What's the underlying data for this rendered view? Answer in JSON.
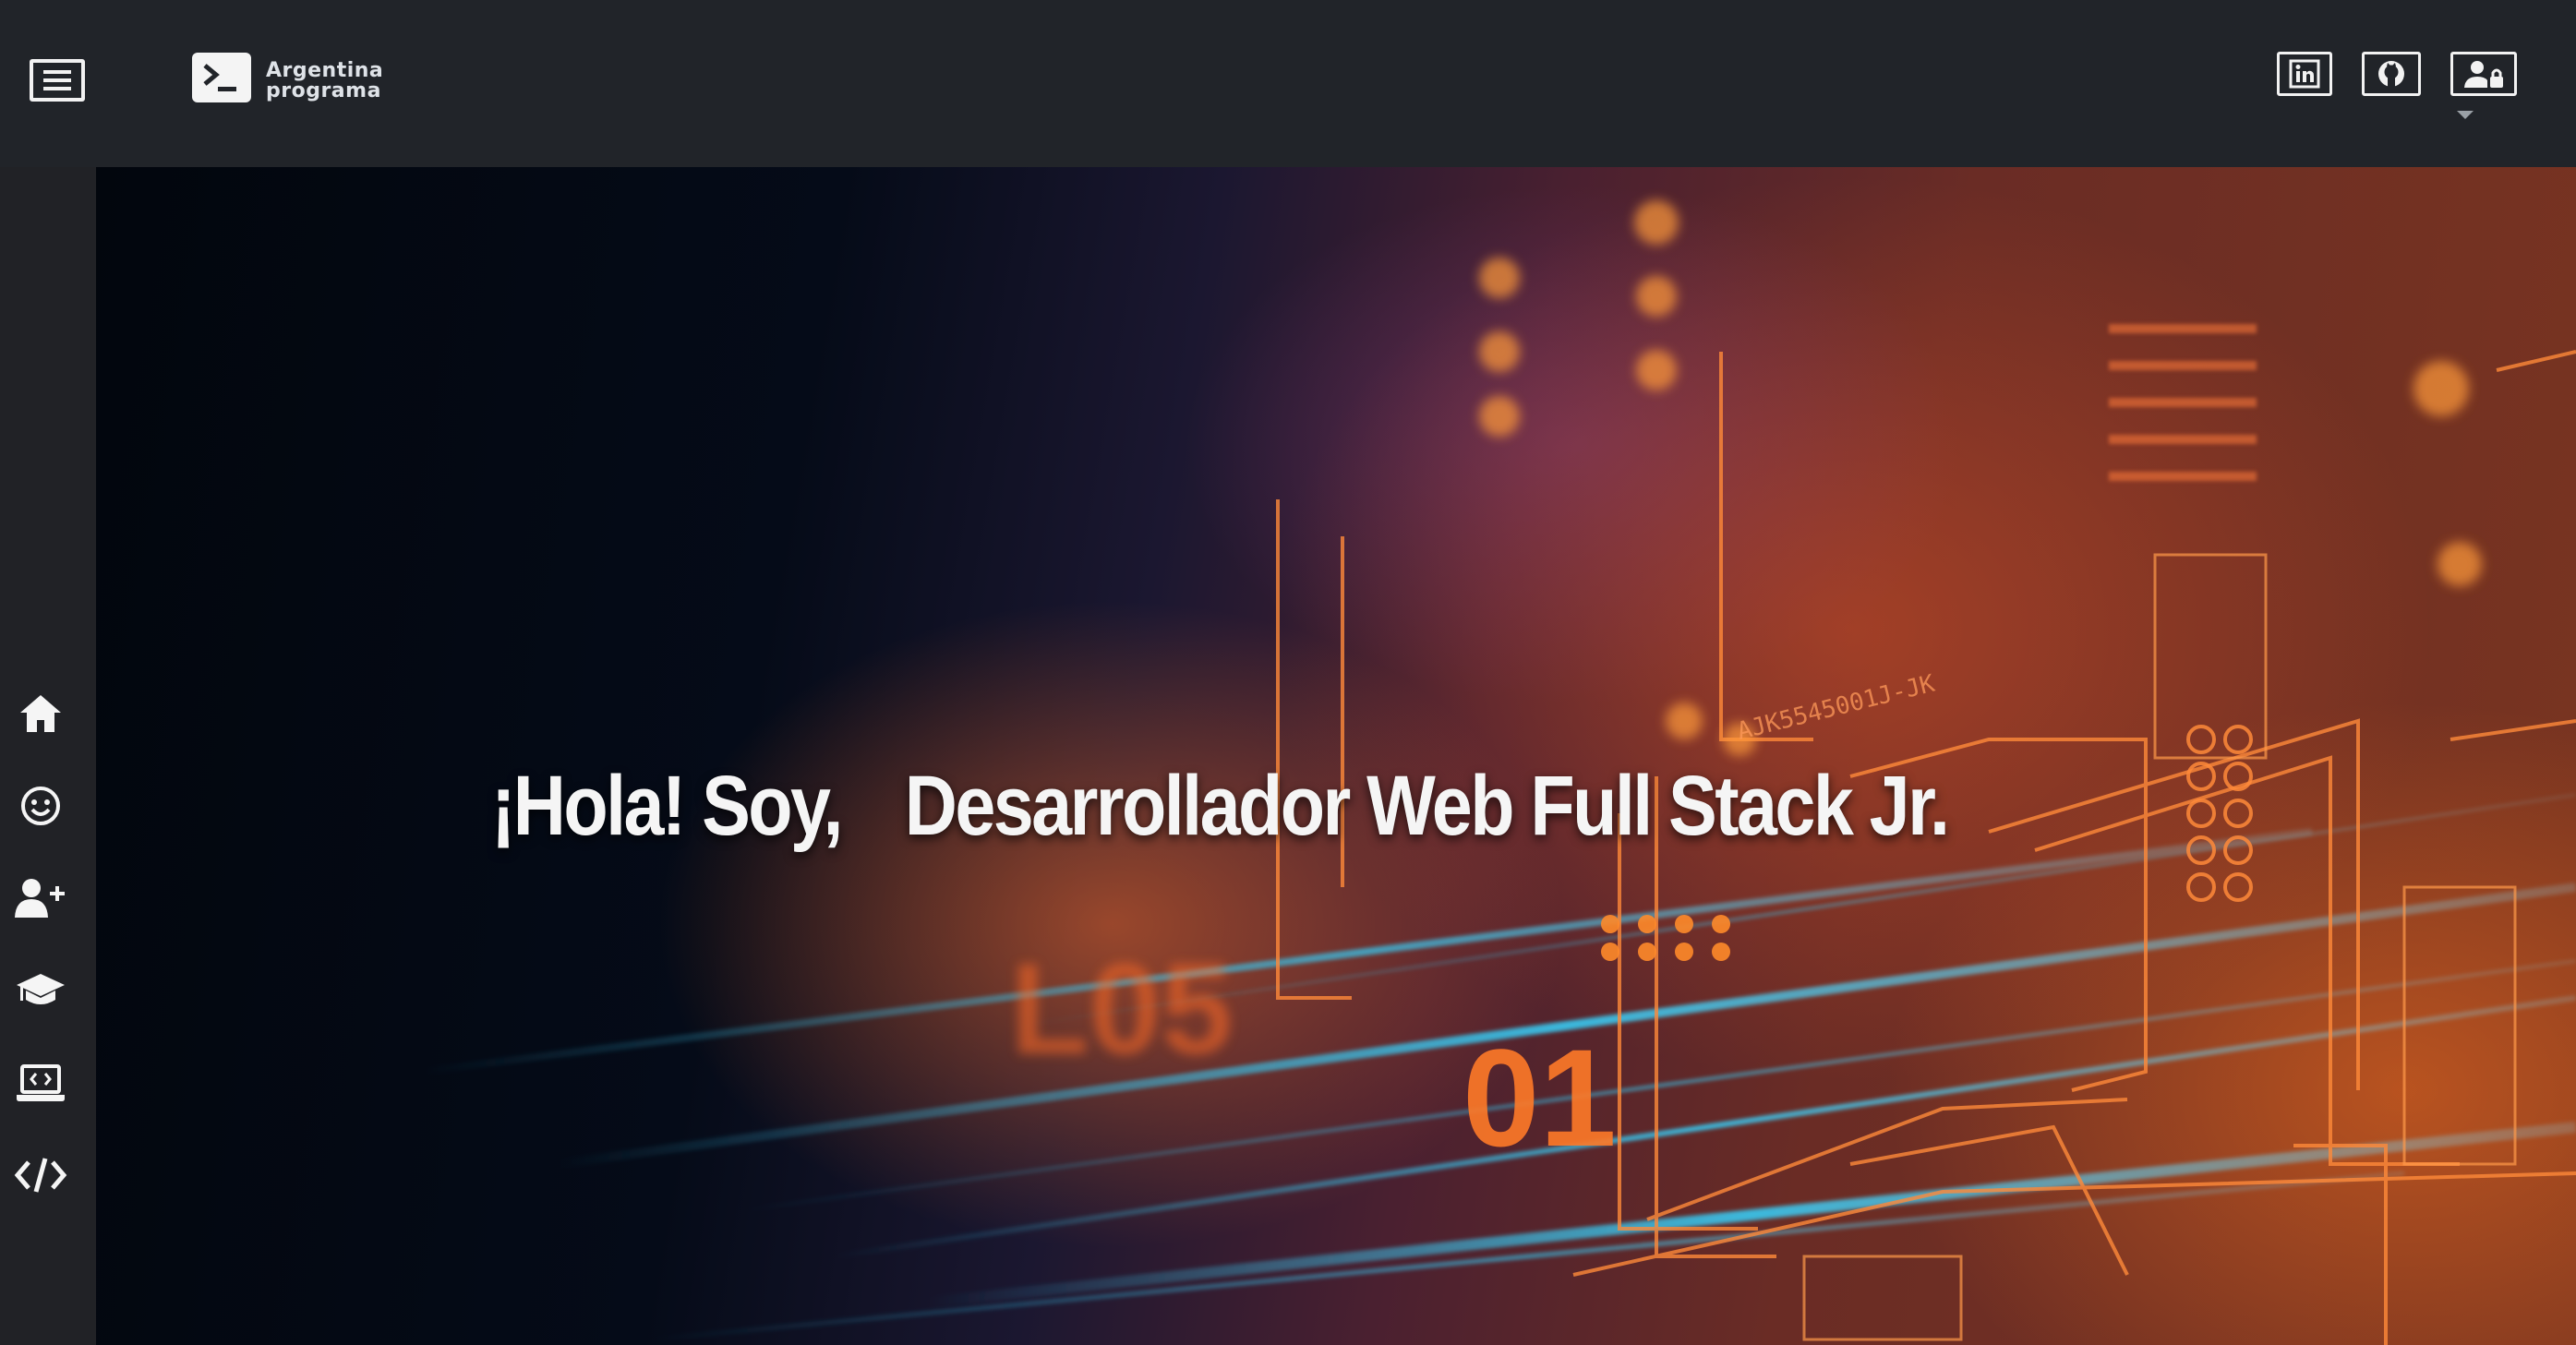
{
  "header": {
    "menu_icon": "hamburger-menu-icon",
    "logo": {
      "icon": "terminal-prompt-icon",
      "line1": "Argentina",
      "line2": "programa"
    },
    "social_links": [
      {
        "name": "linkedin",
        "icon": "linkedin-icon"
      },
      {
        "name": "github",
        "icon": "github-icon"
      },
      {
        "name": "login",
        "icon": "user-lock-icon"
      }
    ],
    "dropdown_icon": "caret-down-icon"
  },
  "sidebar": {
    "items": [
      {
        "name": "home",
        "icon": "home-icon"
      },
      {
        "name": "about",
        "icon": "smile-icon"
      },
      {
        "name": "experience",
        "icon": "user-plus-icon"
      },
      {
        "name": "education",
        "icon": "graduation-cap-icon"
      },
      {
        "name": "projects",
        "icon": "laptop-code-icon"
      },
      {
        "name": "skills",
        "icon": "code-icon"
      }
    ]
  },
  "hero": {
    "greeting": "¡Hola! Soy,",
    "role": "Desarrollador Web Full Stack Jr.",
    "background_text": {
      "code": "AJK5545001J-JK",
      "digits_left": "L05",
      "digits_center": "01"
    }
  },
  "colors": {
    "topbar": "#212429",
    "sidebar": "#212226",
    "accent_orange": "#ff7a2a",
    "accent_cyan": "#38c8f0"
  }
}
